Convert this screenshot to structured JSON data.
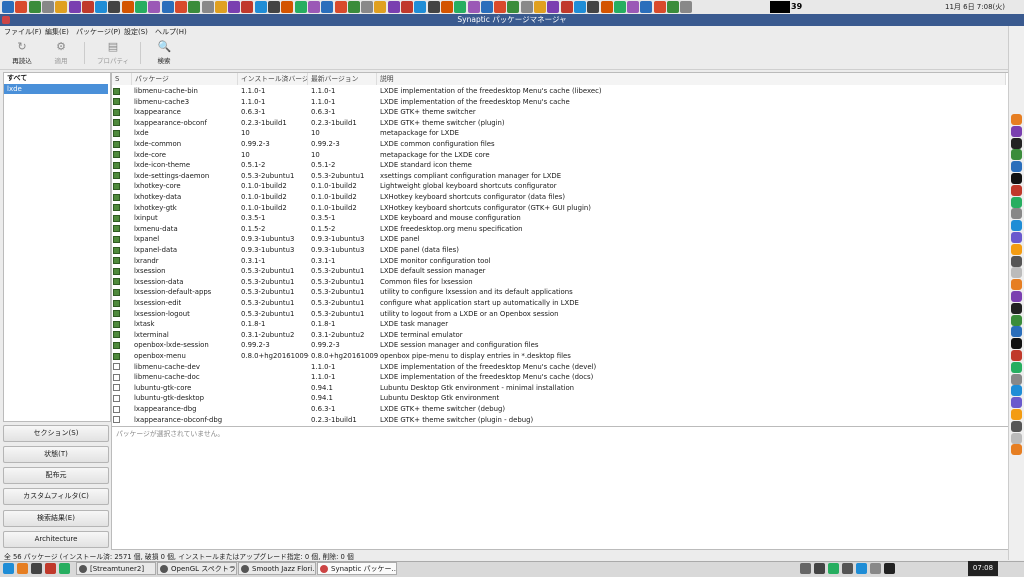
{
  "window": {
    "title": "Synaptic パッケージマネージャ"
  },
  "top_panel": {
    "cpu": "39",
    "clock": "11月 6日 7:08(火)"
  },
  "menu": [
    "ファイル(F)",
    "編集(E)",
    "パッケージ(P)",
    "設定(S)",
    "ヘルプ(H)"
  ],
  "toolbar": {
    "reload": "再読込",
    "apply": "適用",
    "properties": "プロパティ",
    "search": "検索"
  },
  "filters": {
    "all": "すべて",
    "selected": "lxde"
  },
  "side_buttons": [
    "セクション(S)",
    "状態(T)",
    "配布元",
    "カスタムフィルタ(C)",
    "検索結果(E)",
    "Architecture"
  ],
  "table": {
    "headers": {
      "s": "S",
      "package": "パッケージ",
      "installed": "インストール済バージョン",
      "latest": "最新バージョン",
      "description": "説明"
    },
    "rows": [
      {
        "installed_state": true,
        "name": "libmenu-cache-bin",
        "inst": "1.1.0-1",
        "latest": "1.1.0-1",
        "desc": "LXDE implementation of the freedesktop Menu's cache (libexec)"
      },
      {
        "installed_state": true,
        "name": "libmenu-cache3",
        "inst": "1.1.0-1",
        "latest": "1.1.0-1",
        "desc": "LXDE implementation of the freedesktop Menu's cache"
      },
      {
        "installed_state": true,
        "name": "lxappearance",
        "inst": "0.6.3-1",
        "latest": "0.6.3-1",
        "desc": "LXDE GTK+ theme switcher"
      },
      {
        "installed_state": true,
        "name": "lxappearance-obconf",
        "inst": "0.2.3-1build1",
        "latest": "0.2.3-1build1",
        "desc": "LXDE GTK+ theme switcher (plugin)"
      },
      {
        "installed_state": true,
        "name": "lxde",
        "inst": "10",
        "latest": "10",
        "desc": "metapackage for LXDE"
      },
      {
        "installed_state": true,
        "name": "lxde-common",
        "inst": "0.99.2-3",
        "latest": "0.99.2-3",
        "desc": "LXDE common configuration files"
      },
      {
        "installed_state": true,
        "name": "lxde-core",
        "inst": "10",
        "latest": "10",
        "desc": "metapackage for the LXDE core"
      },
      {
        "installed_state": true,
        "name": "lxde-icon-theme",
        "inst": "0.5.1-2",
        "latest": "0.5.1-2",
        "desc": "LXDE standard icon theme"
      },
      {
        "installed_state": true,
        "name": "lxde-settings-daemon",
        "inst": "0.5.3-2ubuntu1",
        "latest": "0.5.3-2ubuntu1",
        "desc": "xsettings compliant configuration manager for LXDE"
      },
      {
        "installed_state": true,
        "name": "lxhotkey-core",
        "inst": "0.1.0-1build2",
        "latest": "0.1.0-1build2",
        "desc": "Lightweight global keyboard shortcuts configurator"
      },
      {
        "installed_state": true,
        "name": "lxhotkey-data",
        "inst": "0.1.0-1build2",
        "latest": "0.1.0-1build2",
        "desc": "LXHotkey keyboard shortcuts configurator (data files)"
      },
      {
        "installed_state": true,
        "name": "lxhotkey-gtk",
        "inst": "0.1.0-1build2",
        "latest": "0.1.0-1build2",
        "desc": "LXHotkey keyboard shortcuts configurator (GTK+ GUI plugin)"
      },
      {
        "installed_state": true,
        "name": "lxinput",
        "inst": "0.3.5-1",
        "latest": "0.3.5-1",
        "desc": "LXDE keyboard and mouse configuration"
      },
      {
        "installed_state": true,
        "name": "lxmenu-data",
        "inst": "0.1.5-2",
        "latest": "0.1.5-2",
        "desc": "LXDE freedesktop.org menu specification"
      },
      {
        "installed_state": true,
        "name": "lxpanel",
        "inst": "0.9.3-1ubuntu3",
        "latest": "0.9.3-1ubuntu3",
        "desc": "LXDE panel"
      },
      {
        "installed_state": true,
        "name": "lxpanel-data",
        "inst": "0.9.3-1ubuntu3",
        "latest": "0.9.3-1ubuntu3",
        "desc": "LXDE panel (data files)"
      },
      {
        "installed_state": true,
        "name": "lxrandr",
        "inst": "0.3.1-1",
        "latest": "0.3.1-1",
        "desc": "LXDE monitor configuration tool"
      },
      {
        "installed_state": true,
        "name": "lxsession",
        "inst": "0.5.3-2ubuntu1",
        "latest": "0.5.3-2ubuntu1",
        "desc": "LXDE default session manager"
      },
      {
        "installed_state": true,
        "name": "lxsession-data",
        "inst": "0.5.3-2ubuntu1",
        "latest": "0.5.3-2ubuntu1",
        "desc": "Common files for lxsession"
      },
      {
        "installed_state": true,
        "name": "lxsession-default-apps",
        "inst": "0.5.3-2ubuntu1",
        "latest": "0.5.3-2ubuntu1",
        "desc": "utility to configure lxsession and its default applications"
      },
      {
        "installed_state": true,
        "name": "lxsession-edit",
        "inst": "0.5.3-2ubuntu1",
        "latest": "0.5.3-2ubuntu1",
        "desc": "configure what application start up automatically in LXDE"
      },
      {
        "installed_state": true,
        "name": "lxsession-logout",
        "inst": "0.5.3-2ubuntu1",
        "latest": "0.5.3-2ubuntu1",
        "desc": "utility to logout from a LXDE or an Openbox session"
      },
      {
        "installed_state": true,
        "name": "lxtask",
        "inst": "0.1.8-1",
        "latest": "0.1.8-1",
        "desc": "LXDE task manager"
      },
      {
        "installed_state": true,
        "name": "lxterminal",
        "inst": "0.3.1-2ubuntu2",
        "latest": "0.3.1-2ubuntu2",
        "desc": "LXDE terminal emulator"
      },
      {
        "installed_state": true,
        "name": "openbox-lxde-session",
        "inst": "0.99.2-3",
        "latest": "0.99.2-3",
        "desc": "LXDE session manager and configuration files"
      },
      {
        "installed_state": true,
        "name": "openbox-menu",
        "inst": "0.8.0+hg20161009-",
        "latest": "0.8.0+hg20161009-",
        "desc": "openbox pipe-menu to display entries in *.desktop files"
      },
      {
        "installed_state": false,
        "name": "libmenu-cache-dev",
        "inst": "",
        "latest": "1.1.0-1",
        "desc": "LXDE implementation of the freedesktop Menu's cache (devel)"
      },
      {
        "installed_state": false,
        "name": "libmenu-cache-doc",
        "inst": "",
        "latest": "1.1.0-1",
        "desc": "LXDE implementation of the freedesktop Menu's cache (docs)"
      },
      {
        "installed_state": false,
        "name": "lubuntu-gtk-core",
        "inst": "",
        "latest": "0.94.1",
        "desc": "Lubuntu Desktop Gtk environment - minimal installation"
      },
      {
        "installed_state": false,
        "name": "lubuntu-gtk-desktop",
        "inst": "",
        "latest": "0.94.1",
        "desc": "Lubuntu Desktop Gtk environment"
      },
      {
        "installed_state": false,
        "name": "lxappearance-dbg",
        "inst": "",
        "latest": "0.6.3-1",
        "desc": "LXDE GTK+ theme switcher (debug)"
      },
      {
        "installed_state": false,
        "name": "lxappearance-obconf-dbg",
        "inst": "",
        "latest": "0.2.3-1build1",
        "desc": "LXDE GTK+ theme switcher (plugin - debug)"
      }
    ]
  },
  "detail": {
    "placeholder": "パッケージが選択されていません。"
  },
  "status": {
    "text": "全 56 パッケージ (インストール済: 2571 個, 破損 0 個, インストールまたはアップグレード指定: 0 個, 削除: 0 個"
  },
  "taskbar": {
    "tasks": [
      "[Streamtuner2]",
      "OpenGL スペクトラ...",
      "Smooth Jazz Flori...",
      "Synaptic パッケー..."
    ],
    "clock": "07:08"
  },
  "colors": {
    "titlebar": "#3a5a8f",
    "selection": "#4a90d9",
    "installed": "#4f8a3c"
  }
}
